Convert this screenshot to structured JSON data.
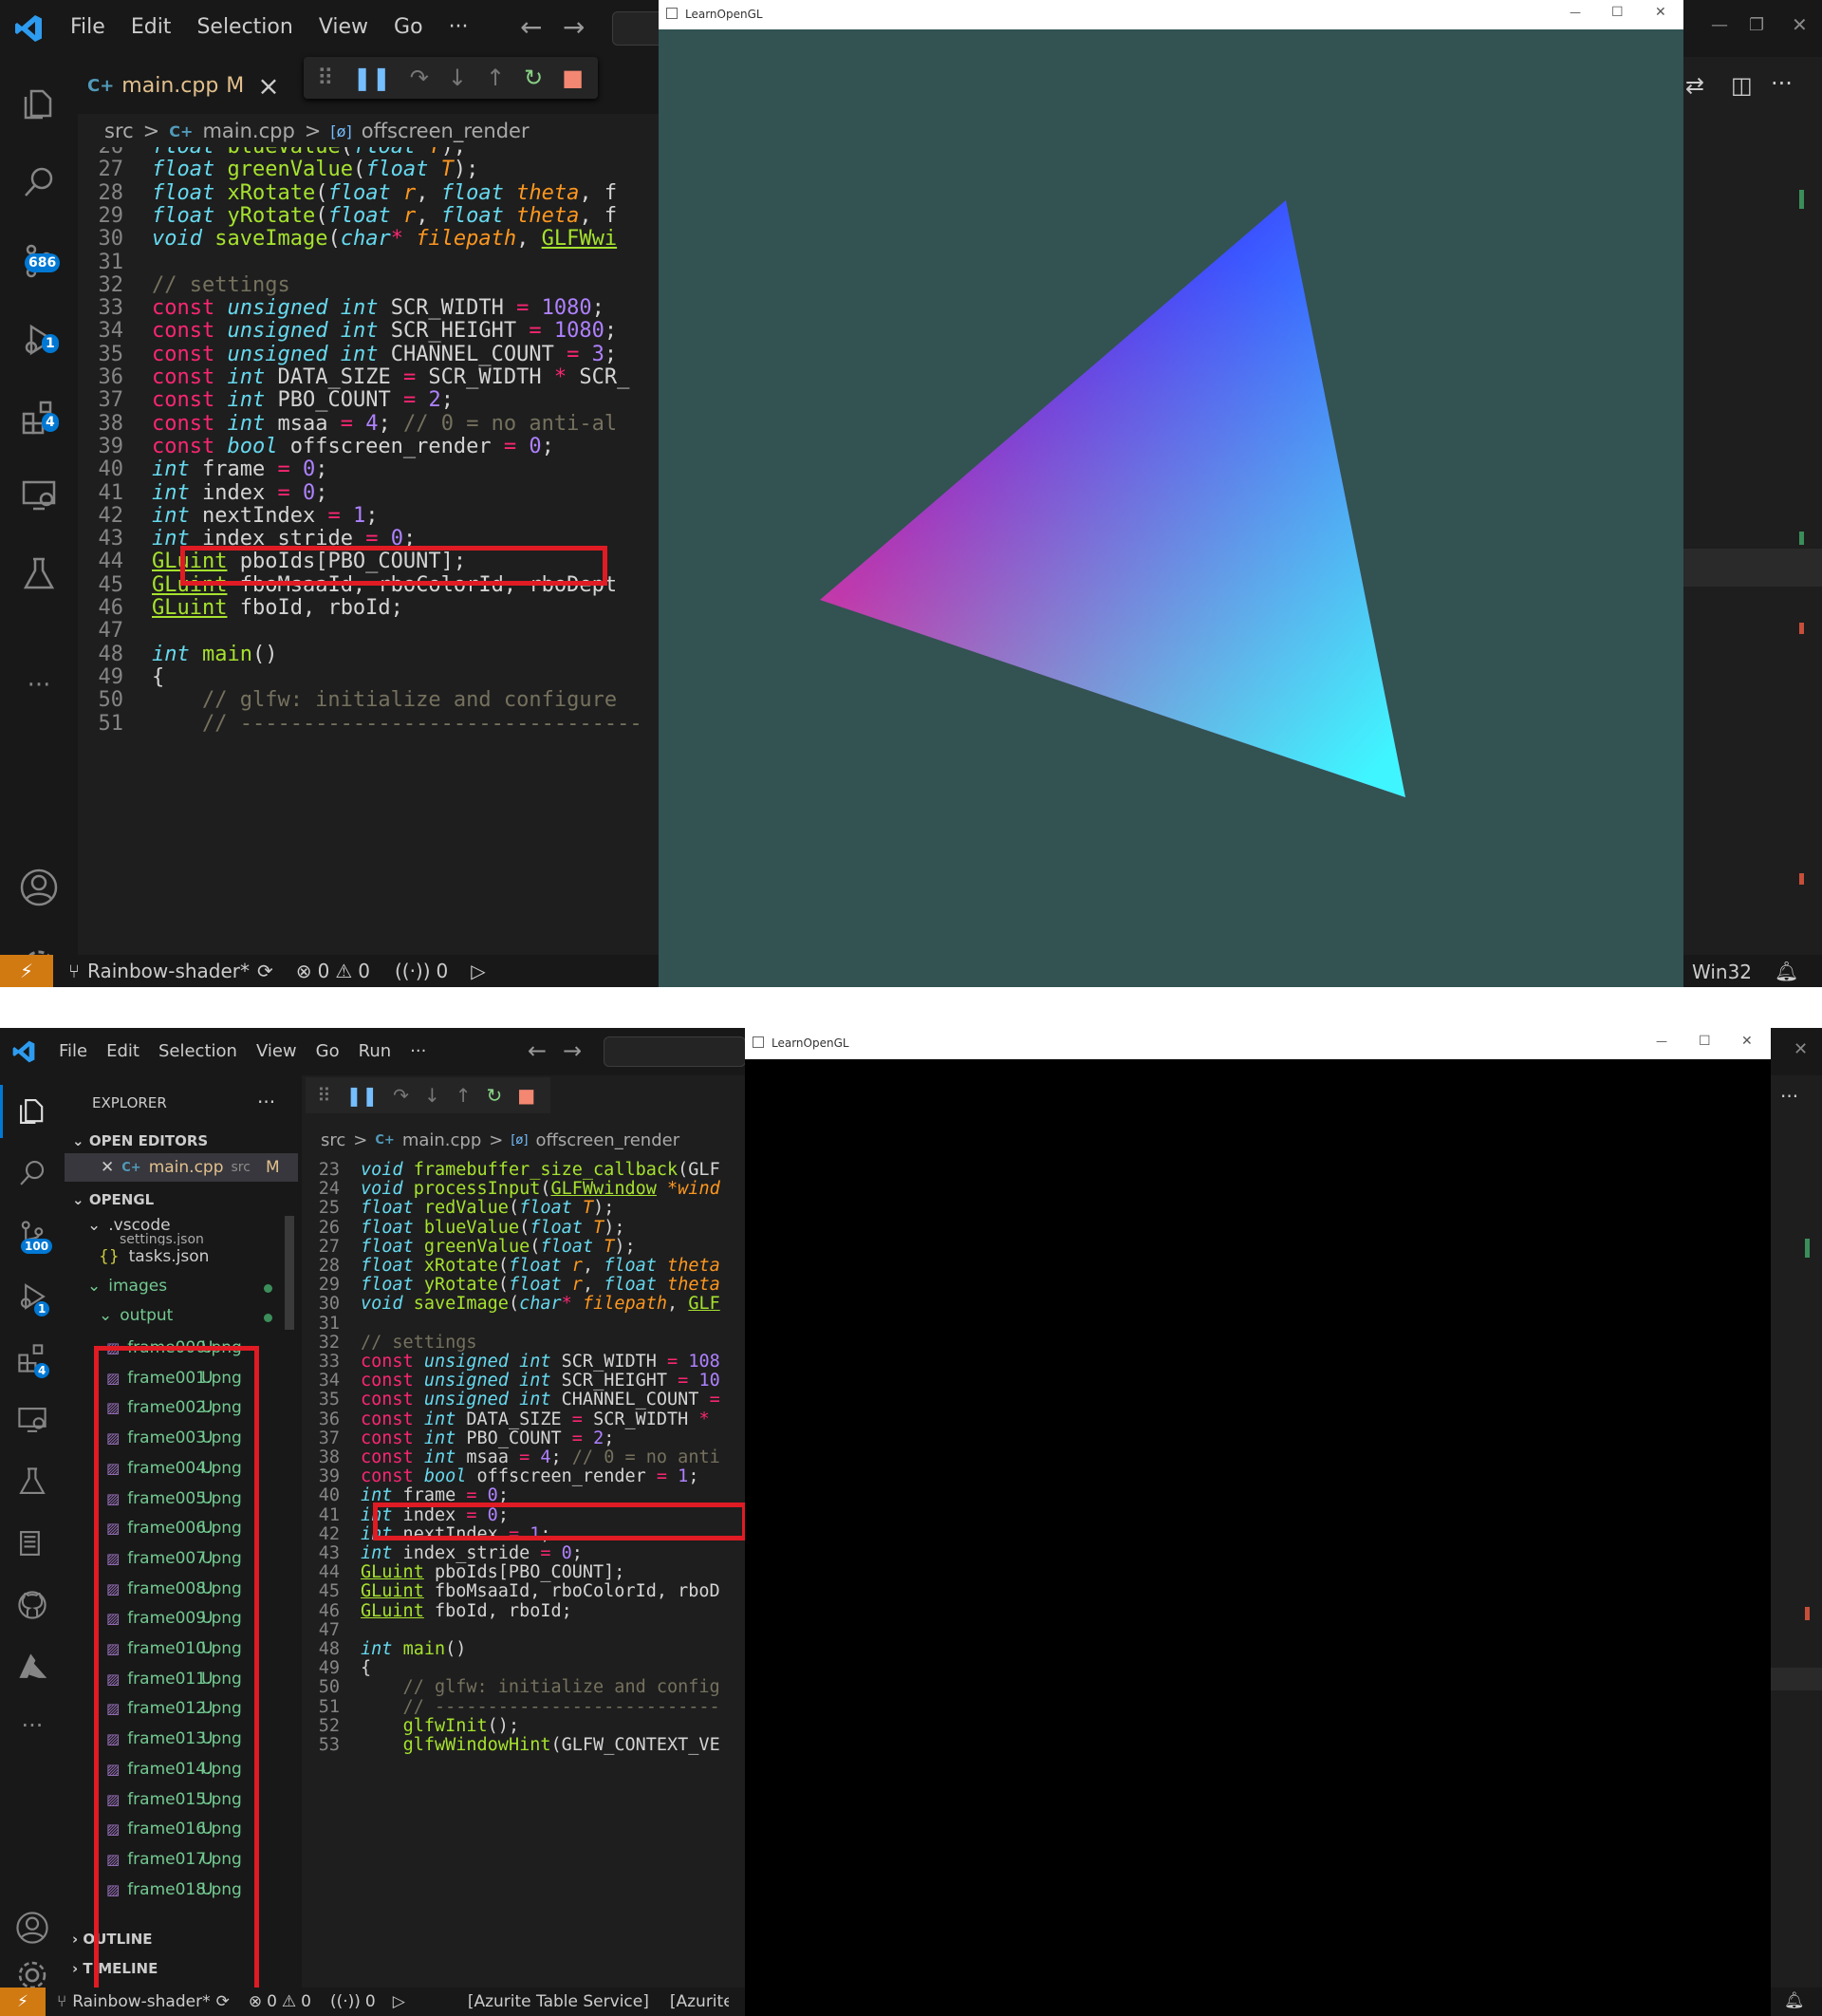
{
  "menu1": [
    "File",
    "Edit",
    "Selection",
    "View",
    "Go",
    "···"
  ],
  "menu2": [
    "File",
    "Edit",
    "Selection",
    "View",
    "Go",
    "Run",
    "···"
  ],
  "tab1": {
    "name": "main.cpp",
    "flag": "M",
    "close": "×"
  },
  "crumbs": {
    "folder": "src",
    "file": "main.cpp",
    "symbol": "offscreen_render",
    "sep": ">"
  },
  "badges": {
    "scm1": "686",
    "scm2": "100",
    "debug": "1",
    "ext": "4"
  },
  "status": {
    "branch": "Rainbow-shader*",
    "errors": "0",
    "warnings": "0",
    "ports": "0",
    "platform": "Win32",
    "azurite1": "[Azurite Table Service]",
    "azurite2": "[Azurite C"
  },
  "glwindow": {
    "title": "LearnOpenGL",
    "min": "—",
    "max": "☐",
    "close": "✕"
  },
  "explorer": {
    "title": "EXPLORER",
    "more": "···",
    "open_editors": "OPEN EDITORS",
    "open_file": "main.cpp",
    "open_file_dir": "src",
    "open_file_flag": "M",
    "project": "OPENGL",
    "vscode": ".vscode",
    "settings": "settings.json",
    "tasks": "tasks.json",
    "images": "images",
    "output": "output",
    "outline": "OUTLINE",
    "timeline": "TIMELINE",
    "untracked": "U",
    "files": [
      "frame000.png",
      "frame001.png",
      "frame002.png",
      "frame003.png",
      "frame004.png",
      "frame005.png",
      "frame006.png",
      "frame007.png",
      "frame008.png",
      "frame009.png",
      "frame010.png",
      "frame011.png",
      "frame012.png",
      "frame013.png",
      "frame014.png",
      "frame015.png",
      "frame016.png",
      "frame017.png",
      "frame018.png"
    ]
  },
  "colors": {
    "clear_color": "#335252",
    "tri_top": "#3b46ff",
    "tri_left": "#f2348c",
    "tri_right": "#3ff5ff",
    "status_remote": "#d17a12",
    "highlight": "#e01b24"
  },
  "code1_lines": [
    [
      [
        "26",
        "ln"
      ],
      [
        "float",
        "ty"
      ],
      [
        " ",
        ""
      ],
      [
        "blueValue",
        "fn"
      ],
      [
        "(",
        ""
      ],
      [
        "float",
        "ty"
      ],
      [
        " ",
        ""
      ],
      [
        "T",
        "pm"
      ],
      [
        ");",
        ""
      ]
    ],
    [
      [
        "27",
        "ln"
      ],
      [
        "float",
        "ty"
      ],
      [
        " ",
        ""
      ],
      [
        "greenValue",
        "fn"
      ],
      [
        "(",
        ""
      ],
      [
        "float",
        "ty"
      ],
      [
        " ",
        ""
      ],
      [
        "T",
        "pm"
      ],
      [
        ");",
        ""
      ]
    ],
    [
      [
        "28",
        "ln"
      ],
      [
        "float",
        "ty"
      ],
      [
        " ",
        ""
      ],
      [
        "xRotate",
        "fn"
      ],
      [
        "(",
        ""
      ],
      [
        "float",
        "ty"
      ],
      [
        " ",
        ""
      ],
      [
        "r",
        "pm"
      ],
      [
        ", ",
        ""
      ],
      [
        "float",
        "ty"
      ],
      [
        " ",
        ""
      ],
      [
        "theta",
        "pm"
      ],
      [
        ", f",
        ""
      ]
    ],
    [
      [
        "29",
        "ln"
      ],
      [
        "float",
        "ty"
      ],
      [
        " ",
        ""
      ],
      [
        "yRotate",
        "fn"
      ],
      [
        "(",
        ""
      ],
      [
        "float",
        "ty"
      ],
      [
        " ",
        ""
      ],
      [
        "r",
        "pm"
      ],
      [
        ", ",
        ""
      ],
      [
        "float",
        "ty"
      ],
      [
        " ",
        ""
      ],
      [
        "theta",
        "pm"
      ],
      [
        ", f",
        ""
      ]
    ],
    [
      [
        "30",
        "ln"
      ],
      [
        "void",
        "ty"
      ],
      [
        " ",
        ""
      ],
      [
        "saveImage",
        "fn"
      ],
      [
        "(",
        ""
      ],
      [
        "char",
        "ty"
      ],
      [
        "*",
        "kw"
      ],
      [
        " ",
        ""
      ],
      [
        "filepath",
        "pm"
      ],
      [
        ", ",
        ""
      ],
      [
        "GLFWwi",
        "ul"
      ]
    ],
    [
      [
        "31",
        "ln"
      ]
    ],
    [
      [
        "32",
        "ln"
      ],
      [
        "// settings",
        "cm"
      ]
    ],
    [
      [
        "33",
        "ln"
      ],
      [
        "const",
        "kw"
      ],
      [
        " ",
        ""
      ],
      [
        "unsigned",
        "ty"
      ],
      [
        " ",
        ""
      ],
      [
        "int",
        "ty"
      ],
      [
        " SCR_WIDTH ",
        ""
      ],
      [
        "=",
        "kw"
      ],
      [
        " ",
        ""
      ],
      [
        "1080",
        "nm"
      ],
      [
        ";",
        ""
      ]
    ],
    [
      [
        "34",
        "ln"
      ],
      [
        "const",
        "kw"
      ],
      [
        " ",
        ""
      ],
      [
        "unsigned",
        "ty"
      ],
      [
        " ",
        ""
      ],
      [
        "int",
        "ty"
      ],
      [
        " SCR_HEIGHT ",
        ""
      ],
      [
        "=",
        "kw"
      ],
      [
        " ",
        ""
      ],
      [
        "1080",
        "nm"
      ],
      [
        ";",
        ""
      ]
    ],
    [
      [
        "35",
        "ln"
      ],
      [
        "const",
        "kw"
      ],
      [
        " ",
        ""
      ],
      [
        "unsigned",
        "ty"
      ],
      [
        " ",
        ""
      ],
      [
        "int",
        "ty"
      ],
      [
        " CHANNEL_COUNT ",
        ""
      ],
      [
        "=",
        "kw"
      ],
      [
        " ",
        ""
      ],
      [
        "3",
        "nm"
      ],
      [
        ";",
        ""
      ]
    ],
    [
      [
        "36",
        "ln"
      ],
      [
        "const",
        "kw"
      ],
      [
        " ",
        ""
      ],
      [
        "int",
        "ty"
      ],
      [
        " DATA_SIZE ",
        ""
      ],
      [
        "=",
        "kw"
      ],
      [
        " SCR_WIDTH ",
        ""
      ],
      [
        "*",
        "kw"
      ],
      [
        " SCR_",
        ""
      ]
    ],
    [
      [
        "37",
        "ln"
      ],
      [
        "const",
        "kw"
      ],
      [
        " ",
        ""
      ],
      [
        "int",
        "ty"
      ],
      [
        " PBO_COUNT ",
        ""
      ],
      [
        "=",
        "kw"
      ],
      [
        " ",
        ""
      ],
      [
        "2",
        "nm"
      ],
      [
        ";",
        ""
      ]
    ],
    [
      [
        "38",
        "ln"
      ],
      [
        "const",
        "kw"
      ],
      [
        " ",
        ""
      ],
      [
        "int",
        "ty"
      ],
      [
        " msaa ",
        ""
      ],
      [
        "=",
        "kw"
      ],
      [
        " ",
        ""
      ],
      [
        "4",
        "nm"
      ],
      [
        "; ",
        ""
      ],
      [
        "// 0 = no anti-al",
        "cm"
      ]
    ],
    [
      [
        "39",
        "ln"
      ],
      [
        "const",
        "kw"
      ],
      [
        " ",
        ""
      ],
      [
        "bool",
        "ty"
      ],
      [
        " offscreen_render ",
        ""
      ],
      [
        "=",
        "kw"
      ],
      [
        " ",
        ""
      ],
      [
        "0",
        "nm"
      ],
      [
        ";",
        ""
      ]
    ],
    [
      [
        "40",
        "ln"
      ],
      [
        "int",
        "ty"
      ],
      [
        " frame ",
        ""
      ],
      [
        "=",
        "kw"
      ],
      [
        " ",
        ""
      ],
      [
        "0",
        "nm"
      ],
      [
        ";",
        ""
      ]
    ],
    [
      [
        "41",
        "ln"
      ],
      [
        "int",
        "ty"
      ],
      [
        " index ",
        ""
      ],
      [
        "=",
        "kw"
      ],
      [
        " ",
        ""
      ],
      [
        "0",
        "nm"
      ],
      [
        ";",
        ""
      ]
    ],
    [
      [
        "42",
        "ln"
      ],
      [
        "int",
        "ty"
      ],
      [
        " nextIndex ",
        ""
      ],
      [
        "=",
        "kw"
      ],
      [
        " ",
        ""
      ],
      [
        "1",
        "nm"
      ],
      [
        ";",
        ""
      ]
    ],
    [
      [
        "43",
        "ln"
      ],
      [
        "int",
        "ty"
      ],
      [
        " index_stride ",
        ""
      ],
      [
        "=",
        "kw"
      ],
      [
        " ",
        ""
      ],
      [
        "0",
        "nm"
      ],
      [
        ";",
        ""
      ]
    ],
    [
      [
        "44",
        "ln"
      ],
      [
        "GLuint",
        "ul"
      ],
      [
        " pboIds[PBO_COUNT];",
        ""
      ]
    ],
    [
      [
        "45",
        "ln"
      ],
      [
        "GLuint",
        "ul"
      ],
      [
        " fboMsaaId, rboColorId, rboDept",
        ""
      ]
    ],
    [
      [
        "46",
        "ln"
      ],
      [
        "GLuint",
        "ul"
      ],
      [
        " fboId, rboId;",
        ""
      ]
    ],
    [
      [
        "47",
        "ln"
      ]
    ],
    [
      [
        "48",
        "ln"
      ],
      [
        "int",
        "ty"
      ],
      [
        " ",
        ""
      ],
      [
        "main",
        "fn"
      ],
      [
        "()",
        ""
      ]
    ],
    [
      [
        "49",
        "ln"
      ],
      [
        "{",
        ""
      ]
    ],
    [
      [
        "50",
        "ln"
      ],
      [
        "    // glfw: initialize and configure",
        "cm"
      ]
    ],
    [
      [
        "51",
        "ln"
      ],
      [
        "    // --------------------------------",
        "cm"
      ]
    ]
  ],
  "code2_lines": [
    [
      [
        "23",
        "ln"
      ],
      [
        "void",
        "ty"
      ],
      [
        " ",
        ""
      ],
      [
        "framebuffer_size_callback",
        "fn"
      ],
      [
        "(GLF",
        ""
      ]
    ],
    [
      [
        "24",
        "ln"
      ],
      [
        "void",
        "ty"
      ],
      [
        " ",
        ""
      ],
      [
        "processInput",
        "fn"
      ],
      [
        "(",
        ""
      ],
      [
        "GLFWwindow",
        "ul"
      ],
      [
        " ",
        ""
      ],
      [
        "*wind",
        "pm"
      ]
    ],
    [
      [
        "25",
        "ln"
      ],
      [
        "float",
        "ty"
      ],
      [
        " ",
        ""
      ],
      [
        "redValue",
        "fn"
      ],
      [
        "(",
        ""
      ],
      [
        "float",
        "ty"
      ],
      [
        " ",
        ""
      ],
      [
        "T",
        "pm"
      ],
      [
        ");",
        ""
      ]
    ],
    [
      [
        "26",
        "ln"
      ],
      [
        "float",
        "ty"
      ],
      [
        " ",
        ""
      ],
      [
        "blueValue",
        "fn"
      ],
      [
        "(",
        ""
      ],
      [
        "float",
        "ty"
      ],
      [
        " ",
        ""
      ],
      [
        "T",
        "pm"
      ],
      [
        ");",
        ""
      ]
    ],
    [
      [
        "27",
        "ln"
      ],
      [
        "float",
        "ty"
      ],
      [
        " ",
        ""
      ],
      [
        "greenValue",
        "fn"
      ],
      [
        "(",
        ""
      ],
      [
        "float",
        "ty"
      ],
      [
        " ",
        ""
      ],
      [
        "T",
        "pm"
      ],
      [
        ");",
        ""
      ]
    ],
    [
      [
        "28",
        "ln"
      ],
      [
        "float",
        "ty"
      ],
      [
        " ",
        ""
      ],
      [
        "xRotate",
        "fn"
      ],
      [
        "(",
        ""
      ],
      [
        "float",
        "ty"
      ],
      [
        " ",
        ""
      ],
      [
        "r",
        "pm"
      ],
      [
        ", ",
        ""
      ],
      [
        "float",
        "ty"
      ],
      [
        " ",
        ""
      ],
      [
        "theta",
        "pm"
      ]
    ],
    [
      [
        "29",
        "ln"
      ],
      [
        "float",
        "ty"
      ],
      [
        " ",
        ""
      ],
      [
        "yRotate",
        "fn"
      ],
      [
        "(",
        ""
      ],
      [
        "float",
        "ty"
      ],
      [
        " ",
        ""
      ],
      [
        "r",
        "pm"
      ],
      [
        ", ",
        ""
      ],
      [
        "float",
        "ty"
      ],
      [
        " ",
        ""
      ],
      [
        "theta",
        "pm"
      ]
    ],
    [
      [
        "30",
        "ln"
      ],
      [
        "void",
        "ty"
      ],
      [
        " ",
        ""
      ],
      [
        "saveImage",
        "fn"
      ],
      [
        "(",
        ""
      ],
      [
        "char",
        "ty"
      ],
      [
        "*",
        "kw"
      ],
      [
        " ",
        ""
      ],
      [
        "filepath",
        "pm"
      ],
      [
        ", ",
        ""
      ],
      [
        "GLF",
        "ul"
      ]
    ],
    [
      [
        "31",
        "ln"
      ]
    ],
    [
      [
        "32",
        "ln"
      ],
      [
        "// settings",
        "cm"
      ]
    ],
    [
      [
        "33",
        "ln"
      ],
      [
        "const",
        "kw"
      ],
      [
        " ",
        ""
      ],
      [
        "unsigned",
        "ty"
      ],
      [
        " ",
        ""
      ],
      [
        "int",
        "ty"
      ],
      [
        " SCR_WIDTH ",
        ""
      ],
      [
        "=",
        "kw"
      ],
      [
        " ",
        ""
      ],
      [
        "108",
        "nm"
      ]
    ],
    [
      [
        "34",
        "ln"
      ],
      [
        "const",
        "kw"
      ],
      [
        " ",
        ""
      ],
      [
        "unsigned",
        "ty"
      ],
      [
        " ",
        ""
      ],
      [
        "int",
        "ty"
      ],
      [
        " SCR_HEIGHT ",
        ""
      ],
      [
        "=",
        "kw"
      ],
      [
        " ",
        ""
      ],
      [
        "10",
        "nm"
      ]
    ],
    [
      [
        "35",
        "ln"
      ],
      [
        "const",
        "kw"
      ],
      [
        " ",
        ""
      ],
      [
        "unsigned",
        "ty"
      ],
      [
        " ",
        ""
      ],
      [
        "int",
        "ty"
      ],
      [
        " CHANNEL_COUNT ",
        ""
      ],
      [
        "=",
        "kw"
      ]
    ],
    [
      [
        "36",
        "ln"
      ],
      [
        "const",
        "kw"
      ],
      [
        " ",
        ""
      ],
      [
        "int",
        "ty"
      ],
      [
        " DATA_SIZE ",
        ""
      ],
      [
        "=",
        "kw"
      ],
      [
        " SCR_WIDTH ",
        ""
      ],
      [
        "*",
        "kw"
      ]
    ],
    [
      [
        "37",
        "ln"
      ],
      [
        "const",
        "kw"
      ],
      [
        " ",
        ""
      ],
      [
        "int",
        "ty"
      ],
      [
        " PBO_COUNT ",
        ""
      ],
      [
        "=",
        "kw"
      ],
      [
        " ",
        ""
      ],
      [
        "2",
        "nm"
      ],
      [
        ";",
        ""
      ]
    ],
    [
      [
        "38",
        "ln"
      ],
      [
        "const",
        "kw"
      ],
      [
        " ",
        ""
      ],
      [
        "int",
        "ty"
      ],
      [
        " msaa ",
        ""
      ],
      [
        "=",
        "kw"
      ],
      [
        " ",
        ""
      ],
      [
        "4",
        "nm"
      ],
      [
        "; ",
        ""
      ],
      [
        "// 0 = no anti",
        "cm"
      ]
    ],
    [
      [
        "39",
        "ln"
      ],
      [
        "const",
        "kw"
      ],
      [
        " ",
        ""
      ],
      [
        "bool",
        "ty"
      ],
      [
        " offscreen_render ",
        ""
      ],
      [
        "=",
        "kw"
      ],
      [
        " ",
        ""
      ],
      [
        "1",
        "nm"
      ],
      [
        ";",
        ""
      ]
    ],
    [
      [
        "40",
        "ln"
      ],
      [
        "int",
        "ty"
      ],
      [
        " frame ",
        ""
      ],
      [
        "=",
        "kw"
      ],
      [
        " ",
        ""
      ],
      [
        "0",
        "nm"
      ],
      [
        ";",
        ""
      ]
    ],
    [
      [
        "41",
        "ln"
      ],
      [
        "int",
        "ty"
      ],
      [
        " index ",
        ""
      ],
      [
        "=",
        "kw"
      ],
      [
        " ",
        ""
      ],
      [
        "0",
        "nm"
      ],
      [
        ";",
        ""
      ]
    ],
    [
      [
        "42",
        "ln"
      ],
      [
        "int",
        "ty"
      ],
      [
        " nextIndex ",
        ""
      ],
      [
        "=",
        "kw"
      ],
      [
        " ",
        ""
      ],
      [
        "1",
        "nm"
      ],
      [
        ";",
        ""
      ]
    ],
    [
      [
        "43",
        "ln"
      ],
      [
        "int",
        "ty"
      ],
      [
        " index_stride ",
        ""
      ],
      [
        "=",
        "kw"
      ],
      [
        " ",
        ""
      ],
      [
        "0",
        "nm"
      ],
      [
        ";",
        ""
      ]
    ],
    [
      [
        "44",
        "ln"
      ],
      [
        "GLuint",
        "ul"
      ],
      [
        " pboIds[PBO_COUNT];",
        ""
      ]
    ],
    [
      [
        "45",
        "ln"
      ],
      [
        "GLuint",
        "ul"
      ],
      [
        " fboMsaaId, rboColorId, rboD",
        ""
      ]
    ],
    [
      [
        "46",
        "ln"
      ],
      [
        "GLuint",
        "ul"
      ],
      [
        " fboId, rboId;",
        ""
      ]
    ],
    [
      [
        "47",
        "ln"
      ]
    ],
    [
      [
        "48",
        "ln"
      ],
      [
        "int",
        "ty"
      ],
      [
        " ",
        ""
      ],
      [
        "main",
        "fn"
      ],
      [
        "()",
        ""
      ]
    ],
    [
      [
        "49",
        "ln"
      ],
      [
        "{",
        ""
      ]
    ],
    [
      [
        "50",
        "ln"
      ],
      [
        "    // glfw: initialize and config",
        "cm"
      ]
    ],
    [
      [
        "51",
        "ln"
      ],
      [
        "    // ---------------------------",
        "cm"
      ]
    ],
    [
      [
        "52",
        "ln"
      ],
      [
        "    ",
        ""
      ],
      [
        "glfwInit",
        "fn"
      ],
      [
        "();",
        ""
      ]
    ],
    [
      [
        "53",
        "ln"
      ],
      [
        "    ",
        ""
      ],
      [
        "glfwWindowHint",
        "fn"
      ],
      [
        "(GLFW_CONTEXT_VE",
        ""
      ]
    ]
  ]
}
